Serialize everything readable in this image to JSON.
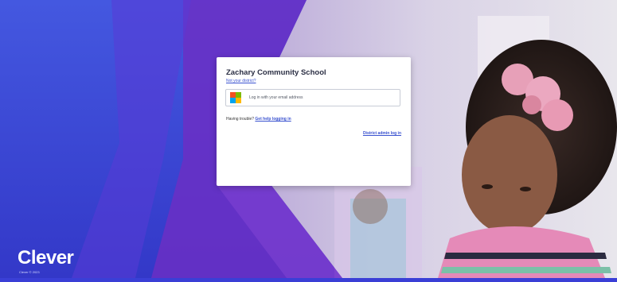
{
  "login": {
    "district_name": "Zachary Community School",
    "not_district_link": "Not your district?",
    "microsoft_button_label": "Log in with your email address",
    "microsoft_icon": "microsoft-logo-icon",
    "trouble_text": "Having trouble?",
    "help_link": "Get help logging in",
    "admin_link": "District admin log in"
  },
  "branding": {
    "logo_text": "Clever",
    "copyright": "Clever © 2023"
  },
  "colors": {
    "background_blue": "#3a3fd6",
    "background_purple": "#6b2fc4",
    "link_blue": "#3a52d0",
    "ms_red": "#f25022",
    "ms_green": "#7fba00",
    "ms_blue": "#00a4ef",
    "ms_yellow": "#ffb900"
  }
}
